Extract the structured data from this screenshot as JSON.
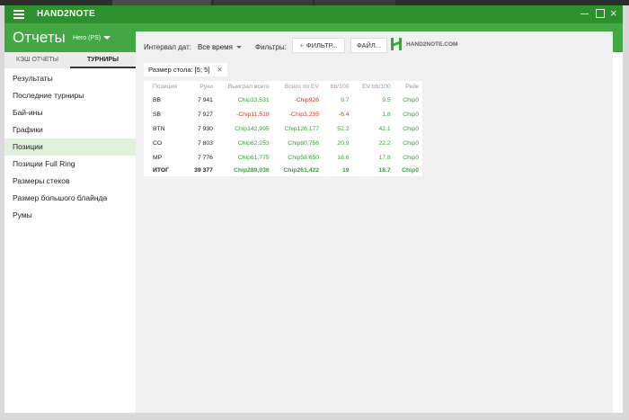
{
  "app": {
    "title": "HAND2NOTE"
  },
  "header": {
    "title": "Отчеты",
    "player": "Hero (PS)"
  },
  "sidebar": {
    "tabs": [
      {
        "label": "КЭШ ОТЧЕТЫ"
      },
      {
        "label": "ТУРНИРЫ"
      }
    ],
    "items": [
      {
        "label": "Результаты"
      },
      {
        "label": "Последние турниры"
      },
      {
        "label": "Бай-ины"
      },
      {
        "label": "Графики"
      },
      {
        "label": "Позиции"
      },
      {
        "label": "Позиции Full Ring"
      },
      {
        "label": "Размеры стеков"
      },
      {
        "label": "Размер большого блайнда"
      },
      {
        "label": "Румы"
      }
    ],
    "active_index": 4
  },
  "filters": {
    "interval_label": "Интервал дат:",
    "interval_value": "Все время",
    "filters_label": "Фильтры:",
    "filter_button": "ФИЛЬТР...",
    "file_button": "ФАЙЛ...",
    "logo_text": "HAND2NOTE.COM",
    "chip": "Размер стола: [5; 5]"
  },
  "table": {
    "headers": [
      "Позиция",
      "Руки",
      "Выиграл всего",
      "Всего по EV",
      "bb/100",
      "EV bb/100",
      "Рейк"
    ],
    "rows": [
      [
        "BB",
        "7 941",
        "Chip33,531",
        "-Chip926",
        "9.7",
        "9.5",
        "Chip0"
      ],
      [
        "SB",
        "7 927",
        "-Chip11,518",
        "-Chip3,235",
        "-6.4",
        "1.8",
        "Chip0"
      ],
      [
        "BTN",
        "7 930",
        "Chip142,995",
        "Chip126,177",
        "52.2",
        "42.1",
        "Chip0"
      ],
      [
        "CO",
        "7 803",
        "Chip62,253",
        "Chip80,756",
        "20.9",
        "22.2",
        "Chip0"
      ],
      [
        "MP",
        "7 776",
        "Chip61,775",
        "Chip58,650",
        "18.6",
        "17.8",
        "Chip0"
      ]
    ],
    "total": [
      "ИТОГ",
      "39 377",
      "Chip289,036",
      "Chip261,422",
      "19",
      "18.7",
      "Chip0"
    ]
  },
  "colors": {
    "accent": "#43a843",
    "titlebar": "#2e8f2e",
    "positive": "#3aa33a",
    "negative": "#d43c2a"
  }
}
